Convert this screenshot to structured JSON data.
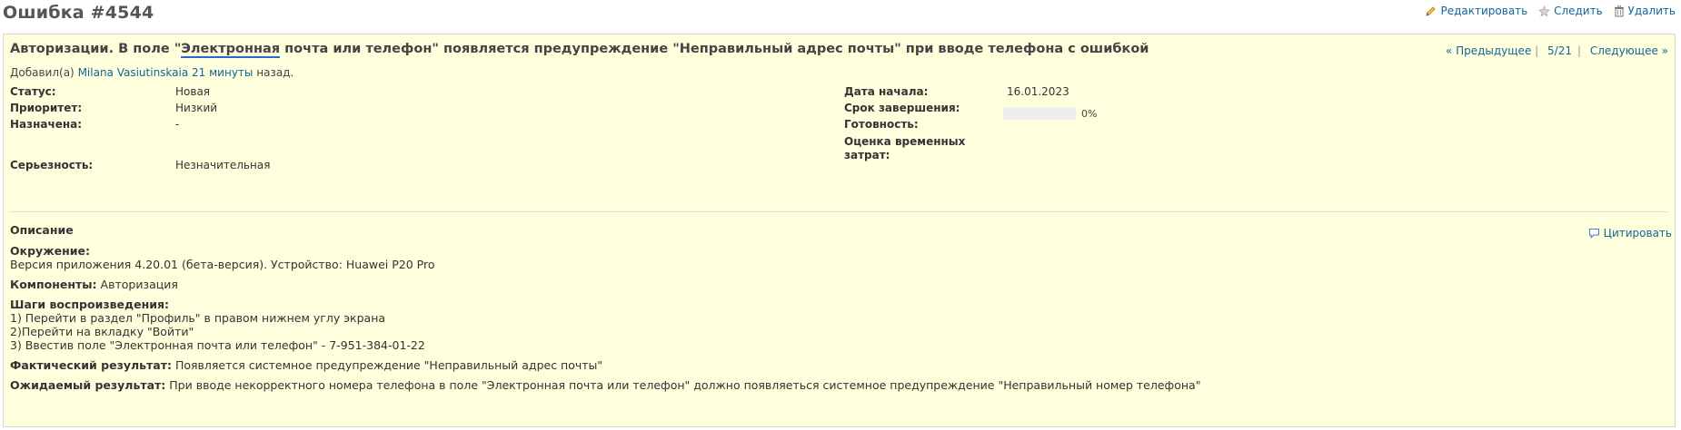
{
  "page": {
    "title": "Ошибка #4544"
  },
  "actions": {
    "edit": "Редактировать",
    "watch": "Следить",
    "delete": "Удалить"
  },
  "issue": {
    "subject_before": "Авторизации. В поле \"",
    "subject_underlined": "Электронная",
    "subject_after": " почта или телефон\" появляется предупреждение \"Неправильный адрес почты\" при вводе телефона с ошибкой",
    "nav": {
      "previous": "« Предыдущее",
      "position": "5/21",
      "next": "Следующее »"
    },
    "author": {
      "prefix": "Добавил(а)",
      "name": "Milana Vasiutinskaia",
      "time": "21 минуты",
      "suffix": "назад."
    },
    "attributes_left": [
      {
        "label": "Статус:",
        "value": "Новая"
      },
      {
        "label": "Приоритет:",
        "value": "Низкий"
      },
      {
        "label": "Назначена:",
        "value": "-"
      },
      {
        "label": "Серьезность:",
        "value": "Незначительная"
      }
    ],
    "attributes_right": [
      {
        "label": "Дата начала:",
        "value": "16.01.2023"
      },
      {
        "label": "Срок завершения:",
        "value": ""
      },
      {
        "label": "Готовность:",
        "value": "0%"
      },
      {
        "label": "Оценка временных затрат:",
        "value": ""
      }
    ],
    "progress_fraction": 0,
    "description": {
      "heading": "Описание",
      "quote": "Цитировать",
      "environment_label": "Окружение:",
      "environment_text": "Версия приложения 4.20.01 (бета-версия). Устройство: Huawei P20 Pro",
      "components_label": "Компоненты:",
      "components_text": "Авторизация",
      "steps_label": "Шаги воспроизведения:",
      "steps": [
        "1) Перейти в раздел \"Профиль\" в правом нижнем углу экрана",
        "2)Перейти на вкладку \"Войти\"",
        "3) Ввестив поле \"Электронная почта или телефон\" - 7-951-384-01-22"
      ],
      "actual_label": "Фактический результат:",
      "actual_text": "Появляется системное предупреждение \"Неправильный адрес почты\"",
      "expected_label": "Ожидаемый результат:",
      "expected_text": "При вводе некорректного номера телефона в поле \"Электронная почта или телефон\" должно появляеться системное предупреждение \"Неправильный номер телефона\""
    }
  },
  "icons": {
    "edit": "pencil-icon",
    "watch": "star-icon",
    "delete": "trash-icon",
    "quote": "speech-bubble-icon"
  },
  "colors": {
    "link": "#116699",
    "issue_background": "#ffffdd",
    "progress_track": "#eeeeee"
  }
}
